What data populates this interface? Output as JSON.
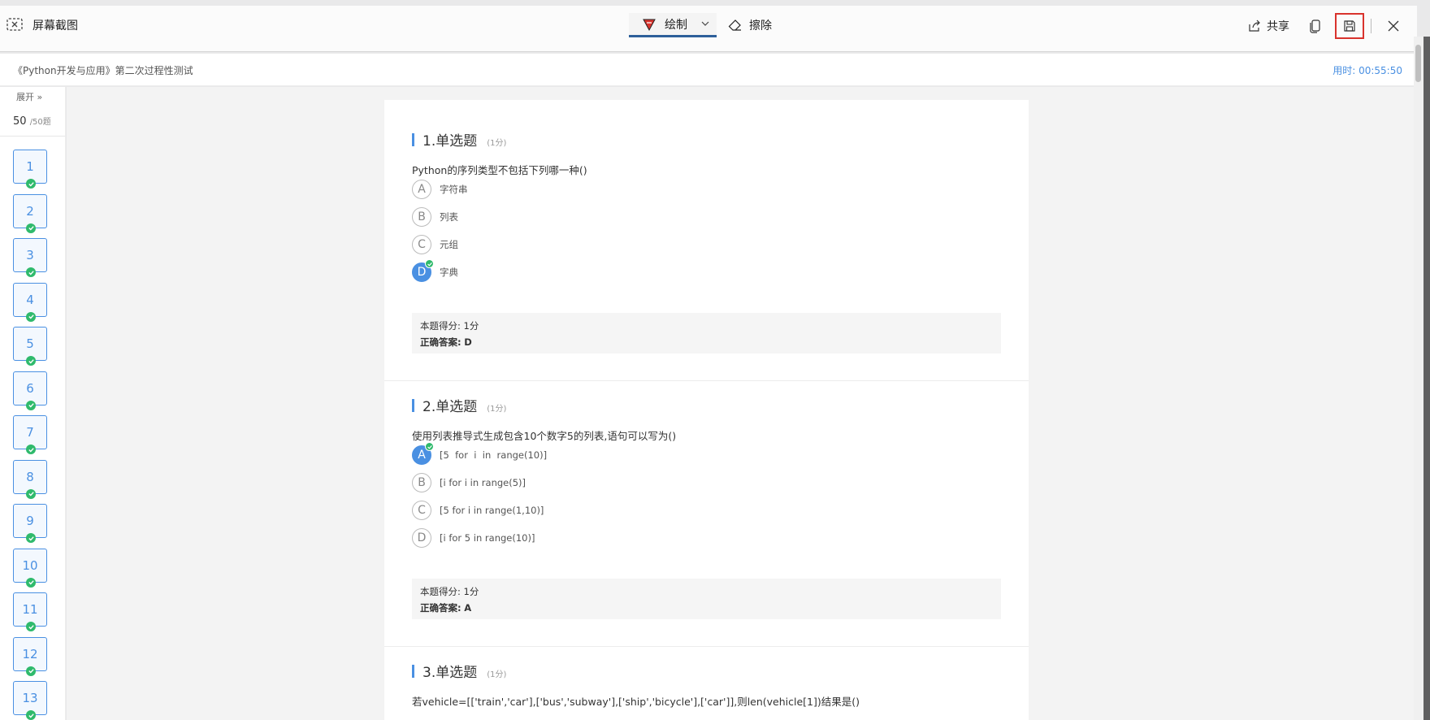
{
  "snip_toolbar": {
    "title": "屏幕截图",
    "draw_label": "绘制",
    "erase_label": "擦除",
    "share_label": "共享"
  },
  "exam": {
    "title": "《Python开发与应用》第二次过程性测试",
    "timer": "用时: 00:55:50"
  },
  "sidebar": {
    "expand_label": "展开 »",
    "answered": "50",
    "total": "/50题",
    "question_numbers": [
      "1",
      "2",
      "3",
      "4",
      "5",
      "6",
      "7",
      "8",
      "9",
      "10",
      "11",
      "12",
      "13"
    ]
  },
  "questions": [
    {
      "title": "1.单选题",
      "points": "(1分)",
      "stem": "Python的序列类型不包括下列哪一种()",
      "options": [
        {
          "letter": "A",
          "text": "字符串",
          "selected": false
        },
        {
          "letter": "B",
          "text": "列表",
          "selected": false
        },
        {
          "letter": "C",
          "text": "元组",
          "selected": false
        },
        {
          "letter": "D",
          "text": "字典",
          "selected": true
        }
      ],
      "score_label": "本题得分:",
      "score_value": "1分",
      "answer_label": "正确答案:",
      "answer_value": "D"
    },
    {
      "title": "2.单选题",
      "points": "(1分)",
      "stem": "使用列表推导式生成包含10个数字5的列表,语句可以写为()",
      "options": [
        {
          "letter": "A",
          "text": "[5  for  i  in  range(10)]",
          "selected": true
        },
        {
          "letter": "B",
          "text": "[i for i in range(5)]",
          "selected": false
        },
        {
          "letter": "C",
          "text": "[5 for i in range(1,10)]",
          "selected": false
        },
        {
          "letter": "D",
          "text": "[i for 5 in range(10)]",
          "selected": false
        }
      ],
      "score_label": "本题得分:",
      "score_value": "1分",
      "answer_label": "正确答案:",
      "answer_value": "A"
    },
    {
      "title": "3.单选题",
      "points": "(1分)",
      "stem": "若vehicle=[['train','car'],['bus','subway'],['ship','bicycle'],['car']],则len(vehicle[1])结果是()"
    }
  ],
  "colors": {
    "accent": "#4a90e2",
    "check": "#2fba6c",
    "save_highlight": "#d9332d"
  }
}
